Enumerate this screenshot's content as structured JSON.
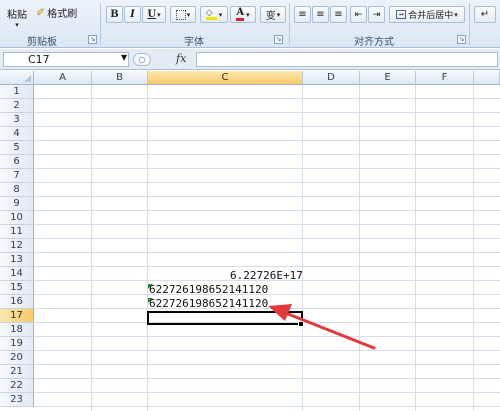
{
  "ribbon": {
    "clipboard": {
      "paste_label": "粘贴",
      "format_painter_label": "格式刷",
      "group_label": "剪贴板"
    },
    "font": {
      "bold_label": "B",
      "italic_label": "I",
      "underline_label": "U",
      "font_color_label": "A",
      "phonetic_label": "变",
      "group_label": "字体"
    },
    "alignment": {
      "merge_center_label": "合并后居中",
      "group_label": "对齐方式"
    }
  },
  "formula_bar": {
    "name_box": "C17",
    "fx_label": "fx",
    "formula": ""
  },
  "sheet": {
    "columns": [
      "A",
      "B",
      "C",
      "D",
      "E",
      "F"
    ],
    "rows": [
      "1",
      "2",
      "3",
      "4",
      "5",
      "6",
      "7",
      "8",
      "9",
      "10",
      "11",
      "12",
      "13",
      "14",
      "15",
      "16",
      "17",
      "18",
      "19",
      "20",
      "21",
      "22",
      "23"
    ],
    "active_cell": "C17",
    "cells": {
      "C14": "6.22726E+17",
      "C15": "622726198652141120",
      "C16": "622726198652141120"
    }
  },
  "colors": {
    "annotation_arrow": "#e03a3a",
    "selection_header": "#f8c96a",
    "text_indicator": "#1e8c3a"
  }
}
